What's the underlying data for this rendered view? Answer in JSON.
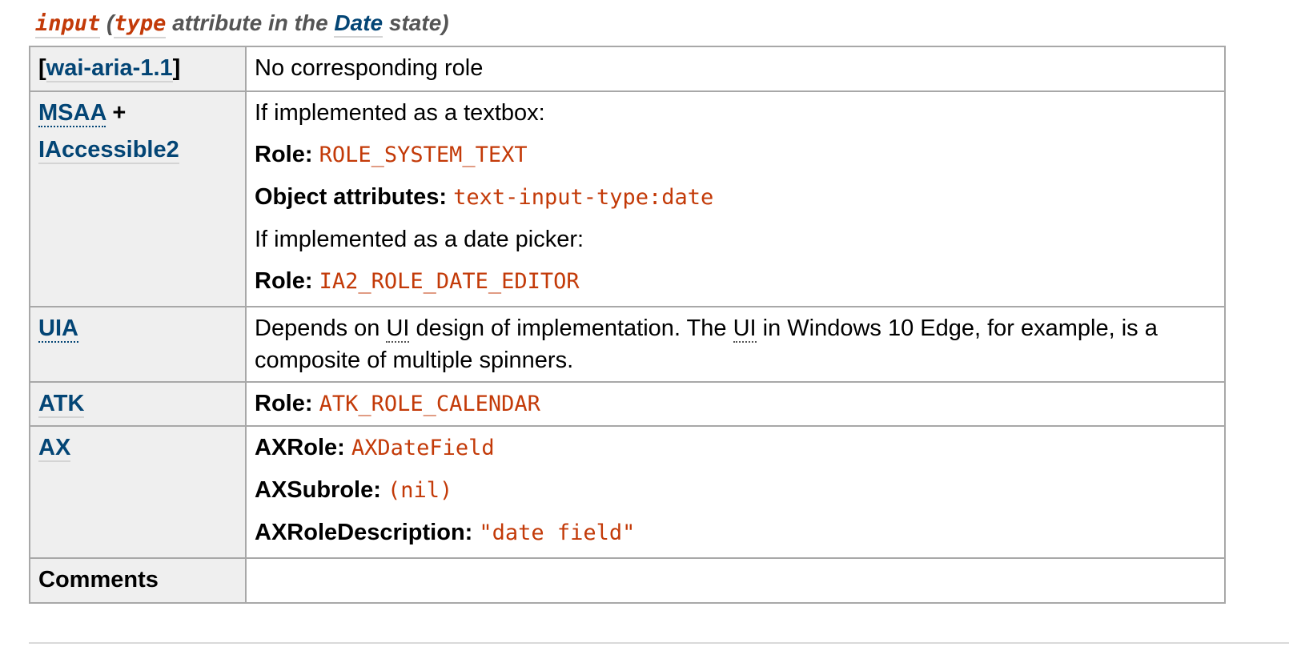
{
  "caption": {
    "element": "input",
    "open_paren": " (",
    "attribute": "type",
    "middle": " attribute in the ",
    "state": "Date",
    "end": " state)"
  },
  "rows": {
    "aria": {
      "header_open": "[",
      "header_link": "wai-aria-1.1",
      "header_close": "]",
      "text": "No corresponding role"
    },
    "msaa": {
      "header_link1": "MSAA",
      "header_plus": " +",
      "header_link2": "IAccessible2",
      "line1": "If implemented as a textbox:",
      "role_label": "Role: ",
      "role_value": "ROLE_SYSTEM_TEXT",
      "obj_label": "Object attributes: ",
      "obj_value": "text-input-type:date",
      "line4": "If implemented as a date picker:",
      "role2_label": "Role: ",
      "role2_value": "IA2_ROLE_DATE_EDITOR"
    },
    "uia": {
      "header_link": "UIA",
      "text_part1": "Depends on ",
      "ui_abbr1": "UI",
      "text_part2": " design of implementation. The ",
      "ui_abbr2": "UI",
      "text_part3": " in Windows 10 Edge, for example, is a composite of multiple spinners."
    },
    "atk": {
      "header_link": "ATK",
      "role_label": "Role: ",
      "role_value": "ATK_ROLE_CALENDAR"
    },
    "ax": {
      "header_link": "AX",
      "role_label": "AXRole: ",
      "role_value": "AXDateField",
      "subrole_label": "AXSubrole: ",
      "subrole_value": "(nil)",
      "desc_label": "AXRoleDescription: ",
      "desc_value": "\"date field\""
    },
    "comments": {
      "header": "Comments",
      "text": ""
    }
  },
  "colors": {
    "link": "#034575",
    "code": "#c33a08",
    "header_bg": "#efefef",
    "border": "#a8a8a8"
  }
}
